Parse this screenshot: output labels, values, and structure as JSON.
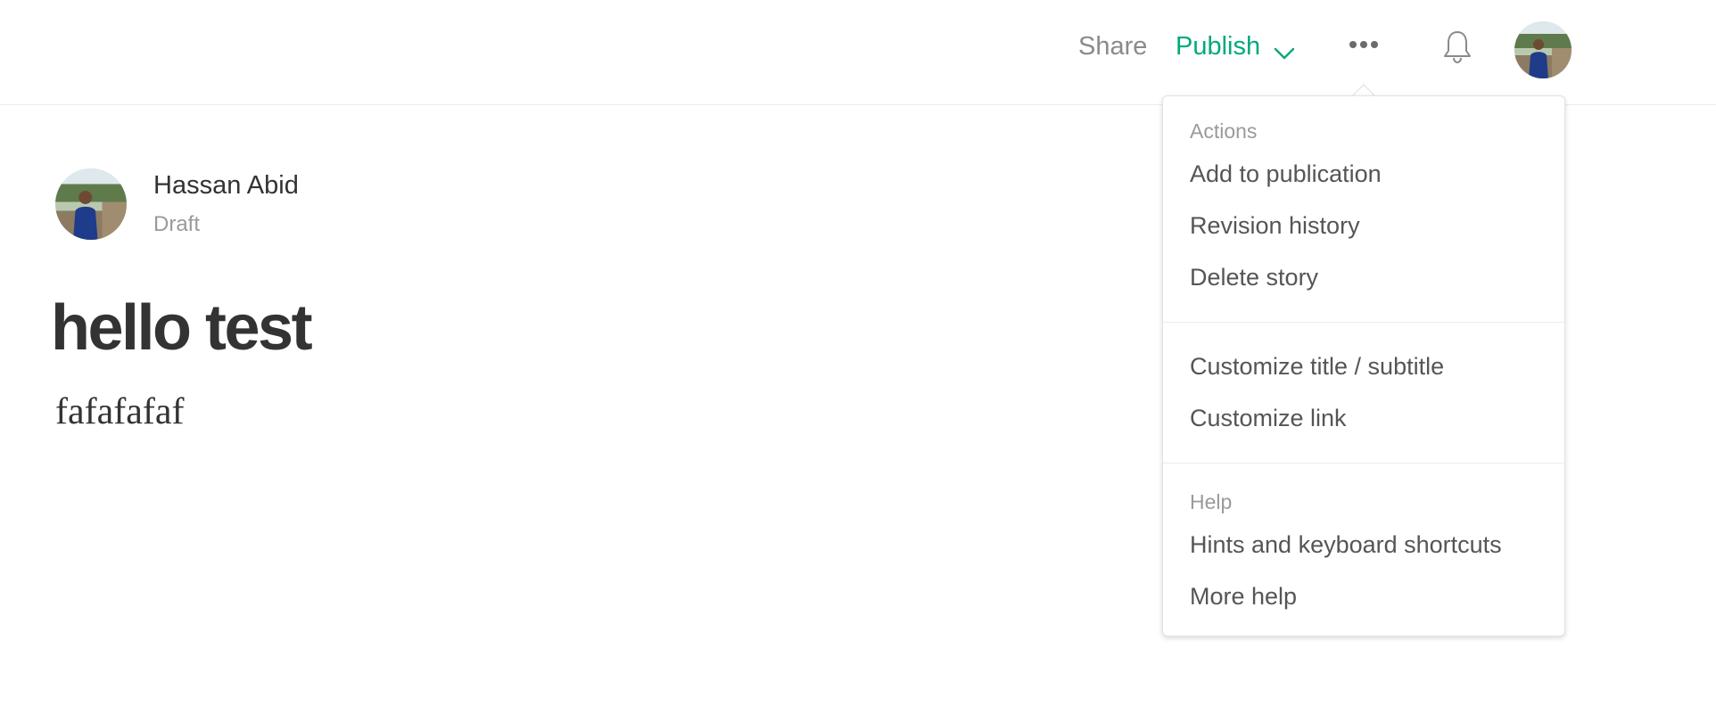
{
  "topbar": {
    "share_label": "Share",
    "publish_label": "Publish"
  },
  "author": {
    "name": "Hassan Abid",
    "status": "Draft"
  },
  "story": {
    "title": "hello test",
    "body": "fafafafaf"
  },
  "menu": {
    "actions_header": "Actions",
    "actions": [
      "Add to publication",
      "Revision history",
      "Delete story"
    ],
    "customize": [
      "Customize title / subtitle",
      "Customize link"
    ],
    "help_header": "Help",
    "help": [
      "Hints and keyboard shortcuts",
      "More help"
    ]
  },
  "colors": {
    "accent": "#03a87c",
    "muted": "#8a8a8a",
    "text": "#333333"
  }
}
